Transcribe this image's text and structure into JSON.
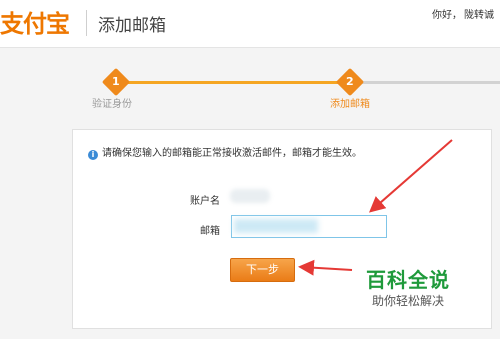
{
  "header": {
    "logo": "支付宝",
    "title": "添加邮箱",
    "greeting": "你好，",
    "username": "陇转诚"
  },
  "steps": [
    {
      "number": "1",
      "label": "验证身份",
      "state": "done"
    },
    {
      "number": "2",
      "label": "添加邮箱",
      "state": "current"
    }
  ],
  "form": {
    "notice": "请确保您输入的邮箱能正常接收激活邮件，邮箱才能生效。",
    "account_label": "账户名",
    "email_label": "邮箱",
    "next_button": "下一步"
  },
  "watermark": {
    "main": "百科全说",
    "sub": "助你轻松解决"
  },
  "colors": {
    "accent": "#ef8a1c",
    "input_border": "#7fc5e8",
    "arrow": "#e53935",
    "watermark": "#1f9a3b"
  }
}
